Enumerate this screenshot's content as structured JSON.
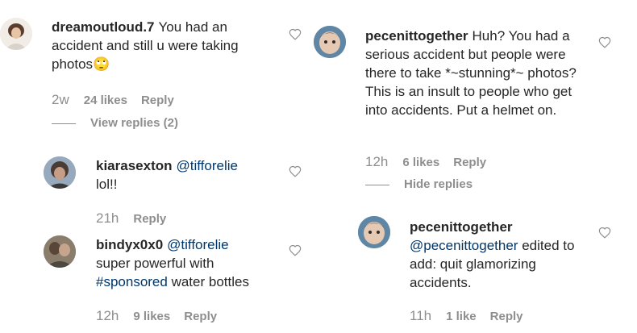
{
  "left": {
    "comment1": {
      "username": "dreamoutloud.7",
      "text": "You had an accident and still u were taking photos",
      "emoji": "🙄",
      "time": "2w",
      "likes": "24 likes",
      "reply": "Reply",
      "view_replies": "View replies (2)"
    },
    "reply1": {
      "username": "kiarasexton",
      "mention": "@tifforelie",
      "text": "lol!!",
      "time": "21h",
      "reply": "Reply"
    },
    "reply2": {
      "username": "bindyx0x0",
      "mention": "@tifforelie",
      "text_before": "super powerful with",
      "hashtag": "#sponsored",
      "text_after": "water bottles",
      "time": "12h",
      "likes": "9 likes",
      "reply": "Reply"
    }
  },
  "right": {
    "comment1": {
      "username": "pecenittogether",
      "text": "Huh? You had a serious accident but people were there to take *~stunning*~ photos? This is an insult to people who get into accidents. Put a helmet on.",
      "time": "12h",
      "likes": "6 likes",
      "reply": "Reply",
      "hide_replies": "Hide replies"
    },
    "reply1": {
      "username": "pecenittogether",
      "mention": "@pecenittogether",
      "text": "edited to add: quit glamorizing accidents.",
      "time": "11h",
      "likes": "1 like",
      "reply": "Reply"
    }
  },
  "colors": {
    "text": "#262626",
    "secondary": "#8e8e8e",
    "link": "#00376b"
  }
}
